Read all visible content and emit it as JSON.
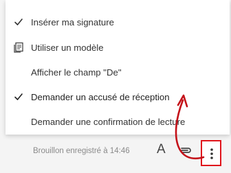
{
  "menu": {
    "items": [
      {
        "label": "Insérer ma signature",
        "icon": "check-icon"
      },
      {
        "label": "Utiliser un modèle",
        "icon": "template-icon"
      },
      {
        "label": "Afficher le champ \"De\"",
        "icon": ""
      },
      {
        "label": "Demander un accusé de réception",
        "icon": "check-icon"
      },
      {
        "label": "Demander une confirmation de lecture",
        "icon": ""
      }
    ]
  },
  "footer": {
    "status": "Brouillon enregistré à 14:46",
    "font_button": "A"
  },
  "colors": {
    "highlight": "#e0141b",
    "text": "#333333",
    "muted": "#8a8a8a"
  }
}
